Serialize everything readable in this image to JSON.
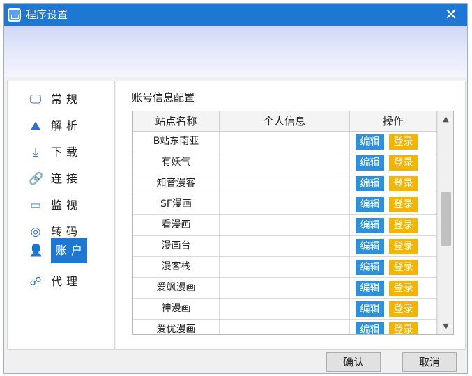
{
  "window": {
    "title": "程序设置",
    "close_symbol": "✕"
  },
  "sidebar": {
    "items": [
      {
        "label": "常规",
        "icon": "monitor-icon",
        "glyph": "🖵",
        "active": false
      },
      {
        "label": "解析",
        "icon": "image-icon",
        "glyph": "⛰",
        "active": false
      },
      {
        "label": "下载",
        "icon": "download-icon",
        "glyph": "⤓",
        "active": false
      },
      {
        "label": "连接",
        "icon": "link-icon",
        "glyph": "🔗",
        "active": false
      },
      {
        "label": "监视",
        "icon": "screen-icon",
        "glyph": "▭",
        "active": false
      },
      {
        "label": "转码",
        "icon": "convert-icon",
        "glyph": "◎",
        "active": false
      },
      {
        "label": "账户",
        "icon": "user-icon",
        "glyph": "👤",
        "active": true
      },
      {
        "label": "代理",
        "icon": "network-icon",
        "glyph": "☍",
        "active": false
      }
    ]
  },
  "main": {
    "group_title": "账号信息配置",
    "table": {
      "headers": [
        "站点名称",
        "个人信息",
        "操作"
      ],
      "edit_label": "编辑",
      "login_label": "登录",
      "rows": [
        {
          "site": "B站东南亚",
          "info": ""
        },
        {
          "site": "有妖气",
          "info": ""
        },
        {
          "site": "知音漫客",
          "info": ""
        },
        {
          "site": "SF漫画",
          "info": ""
        },
        {
          "site": "看漫画",
          "info": ""
        },
        {
          "site": "漫画台",
          "info": ""
        },
        {
          "site": "漫客栈",
          "info": ""
        },
        {
          "site": "爱飒漫画",
          "info": ""
        },
        {
          "site": "神漫画",
          "info": ""
        },
        {
          "site": "爱优漫画",
          "info": ""
        }
      ]
    },
    "scrollbar": {
      "up": "▲",
      "down": "▼"
    }
  },
  "footer": {
    "ok_label": "确认",
    "cancel_label": "取消"
  },
  "colors": {
    "titlebar": "#1e78d3",
    "active_nav": "#1e78d3",
    "edit_button": "#2e8fdc",
    "login_button": "#f5b400"
  }
}
